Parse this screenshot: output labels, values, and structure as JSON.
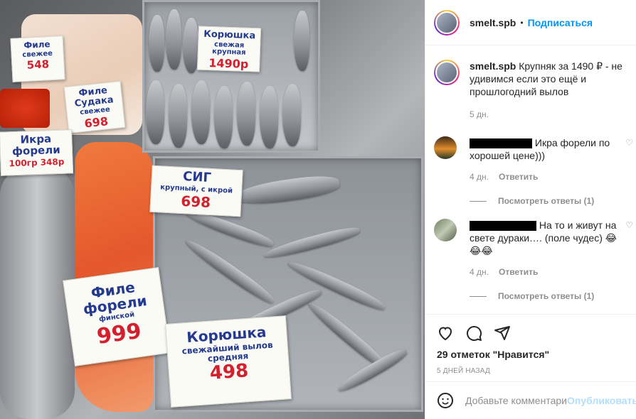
{
  "header": {
    "username": "smelt.spb",
    "separator": "•",
    "follow_label": "Подписаться"
  },
  "caption": {
    "username": "smelt.spb",
    "text": "Крупняк за 1490 ₽ - не удивимся если это ещё и прошлогодний вылов",
    "time": "5 дн."
  },
  "comments": [
    {
      "text": "Икра форели по хорошей цене)))",
      "time": "4 дн.",
      "reply_label": "Ответить",
      "view_replies": "Посмотреть ответы (1)"
    },
    {
      "text": "На то и живут на свете дураки…. (поле чудес) 😂😂😂",
      "time": "4 дн.",
      "reply_label": "Ответить",
      "view_replies": "Посмотреть ответы (1)"
    }
  ],
  "actions": {
    "likes": "29 отметок \"Нравится\"",
    "date": "5 ДНЕЙ НАЗАД"
  },
  "add_comment": {
    "placeholder": "Добавьте комментарий…",
    "publish_label": "Опубликовать"
  },
  "photo": {
    "tags": {
      "koryushka_top": {
        "title": "Корюшка",
        "sub": "свежая крупная",
        "price": "1490р"
      },
      "sig": {
        "title": "СИГ",
        "sub": "крупный, с икрой",
        "price": "698"
      },
      "fillet_skin": {
        "title": "Филе Судака",
        "sub": "свежее",
        "price": "698"
      },
      "ikra": {
        "title": "Икра форели",
        "sub": "100гр 348р"
      },
      "trout": {
        "title": "Филе форели",
        "sub": "финской",
        "price": "999"
      },
      "koryushka_bottom": {
        "title": "Корюшка",
        "sub": "свежайший вылов средняя",
        "price": "498"
      },
      "fillet_top": {
        "title": "Филе",
        "sub": "свежее",
        "price": "548"
      }
    }
  }
}
